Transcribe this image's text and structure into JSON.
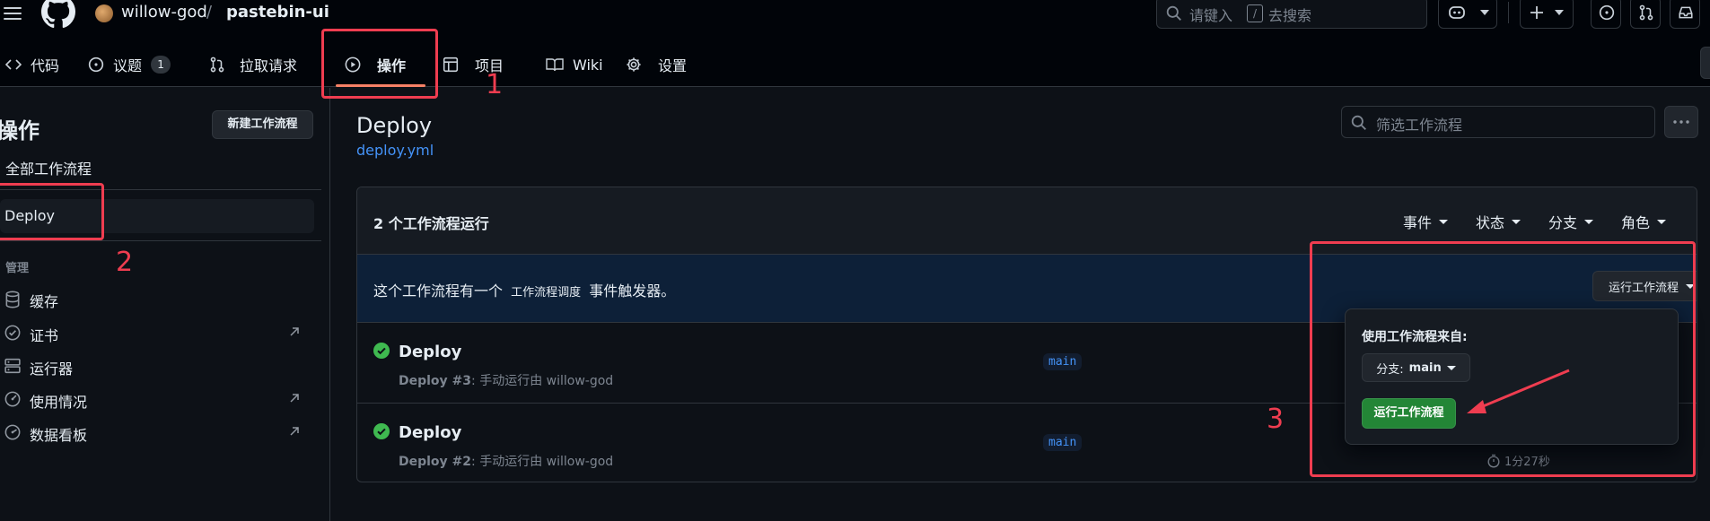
{
  "header": {
    "owner": "willow-god",
    "slash": "/",
    "repo": "pastebin-ui",
    "search": {
      "text_before": "请键入",
      "key": "/",
      "text_after": "去搜索"
    }
  },
  "tabs": [
    {
      "label": "代码",
      "icon": "code-icon"
    },
    {
      "label": "议题",
      "icon": "issue-icon",
      "count": "1"
    },
    {
      "label": "拉取请求",
      "icon": "pull-request-icon"
    },
    {
      "label": "操作",
      "icon": "play-icon",
      "active": true
    },
    {
      "label": "项目",
      "icon": "table-icon"
    },
    {
      "label": "Wiki",
      "icon": "book-icon"
    },
    {
      "label": "设置",
      "icon": "gear-icon"
    }
  ],
  "sidebar": {
    "title": "操作",
    "new_workflow": "新建工作流程",
    "all_workflows": "全部工作流程",
    "selected_workflow": "Deploy",
    "manage_title": "管理",
    "links": [
      {
        "label": "缓存",
        "icon": "database-icon",
        "external": false
      },
      {
        "label": "证书",
        "icon": "check-circle-icon",
        "external": true
      },
      {
        "label": "运行器",
        "icon": "server-icon",
        "external": false
      },
      {
        "label": "使用情况",
        "icon": "meter-icon",
        "external": true
      },
      {
        "label": "数据看板",
        "icon": "graph-icon",
        "external": true
      }
    ]
  },
  "main": {
    "title": "Deploy",
    "file": "deploy.yml",
    "filter_placeholder": "筛选工作流程",
    "runs_count": "2 个工作流程运行",
    "filters": [
      "事件",
      "状态",
      "分支",
      "角色"
    ],
    "dispatch": {
      "text_before": "这个工作流程有一个",
      "event": "工作流程调度",
      "text_after": "事件触发器。",
      "button": "运行工作流程"
    },
    "runs": [
      {
        "name": "Deploy",
        "number": "Deploy #3",
        "desc": ": 手动运行由 willow-god",
        "branch": "main",
        "status": "success"
      },
      {
        "name": "Deploy",
        "number": "Deploy #2",
        "desc": ": 手动运行由 willow-god",
        "branch": "main",
        "status": "success",
        "duration": "1分27秒"
      }
    ]
  },
  "popover": {
    "title": "使用工作流程来自:",
    "branch_label": "分支:",
    "branch_value": "main",
    "run_button": "运行工作流程"
  },
  "annotations": {
    "labels": [
      "1",
      "2",
      "3"
    ],
    "color": "#ef3d50"
  },
  "colors": {
    "accent_link": "#4493f8",
    "success": "#3fb950",
    "primary_button": "#238636",
    "tab_underline": "#f78166"
  }
}
